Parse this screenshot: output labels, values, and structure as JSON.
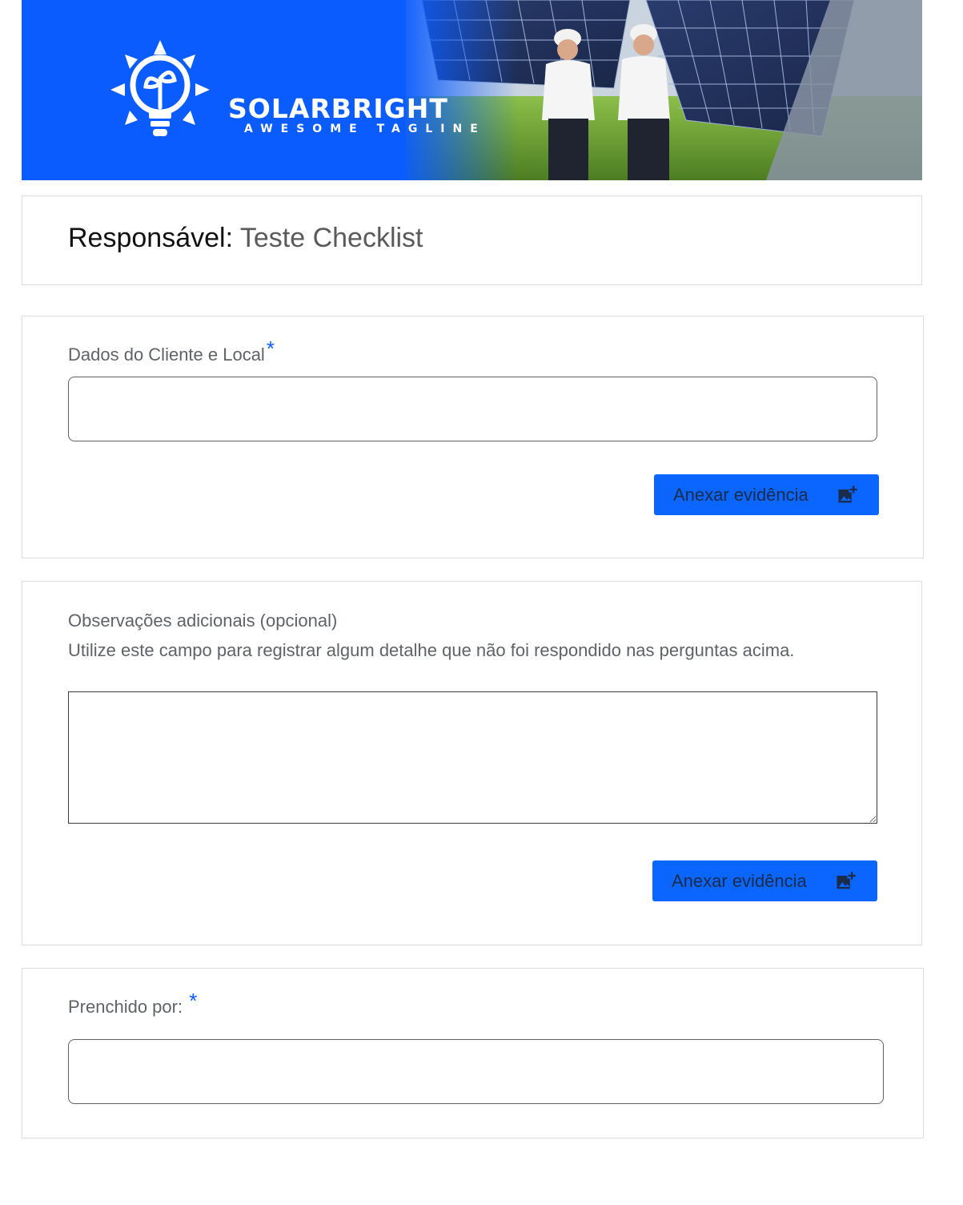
{
  "header": {
    "brand_name": "SOLARBRIGHT",
    "tagline": "AWESOME TAGLINE",
    "brand_color": "#0b5cff"
  },
  "responsavel": {
    "label": "Responsável:",
    "value": "Teste Checklist"
  },
  "questions": [
    {
      "label": "Dados do Cliente e Local",
      "required_marker": "*",
      "input_value": "",
      "attach_label": "Anexar evidência",
      "attach_icon": "add-photo-icon"
    },
    {
      "label": "Observações adicionais (opcional)",
      "description": "Utilize este campo para registrar algum detalhe que não foi respondido nas perguntas acima.",
      "input_value": "",
      "attach_label": "Anexar evidência",
      "attach_icon": "add-photo-icon"
    },
    {
      "label": "Prenchido por: ",
      "required_marker": "*",
      "input_value": ""
    }
  ],
  "colors": {
    "accent": "#0b66ff",
    "required": "#0b5cff",
    "border": "#dadce0"
  }
}
